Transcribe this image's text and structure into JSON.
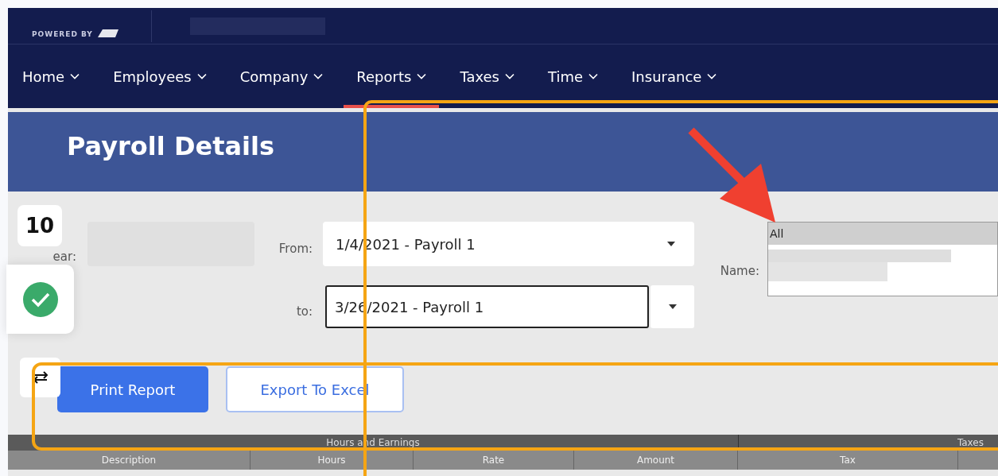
{
  "header": {
    "logo_tagline": "POWERED BY"
  },
  "nav": [
    {
      "label": "Home",
      "selected": false
    },
    {
      "label": "Employees",
      "selected": false
    },
    {
      "label": "Company",
      "selected": false
    },
    {
      "label": "Reports",
      "selected": true
    },
    {
      "label": "Taxes",
      "selected": false
    },
    {
      "label": "Time",
      "selected": false
    },
    {
      "label": "Insurance",
      "selected": false
    }
  ],
  "page_title": "Payroll Details",
  "form": {
    "year_label": "ear:",
    "from_label": "From:",
    "from_value": "1/4/2021 - Payroll 1",
    "to_label": "to:",
    "to_value": "3/26/2021 - Payroll 1",
    "name_label": "Name:",
    "name_options": [
      {
        "label": "All",
        "selected": true
      }
    ]
  },
  "buttons": [
    {
      "label": "Print Report",
      "kind": "primary"
    },
    {
      "label": "Export To Excel",
      "kind": "secondary"
    }
  ],
  "table": {
    "groups": [
      "Hours and Earnings",
      "Taxes"
    ],
    "columns": [
      "Description",
      "Hours",
      "Rate",
      "Amount",
      "Tax"
    ]
  },
  "overlay": {
    "badge": "10"
  }
}
